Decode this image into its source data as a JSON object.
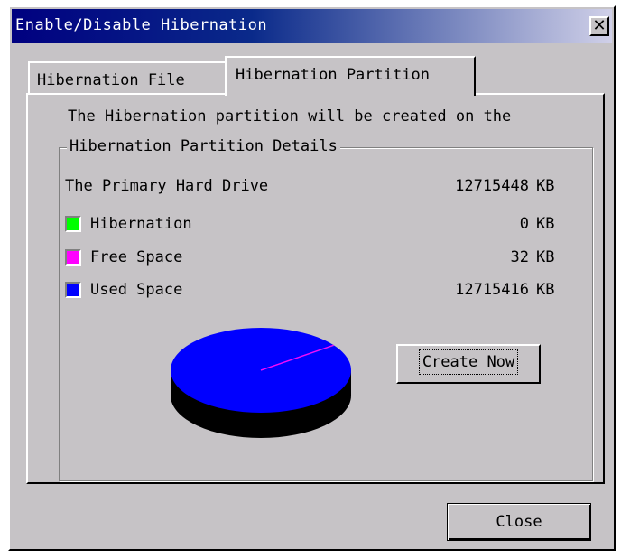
{
  "window": {
    "title": "Enable/Disable Hibernation",
    "close_glyph": "✕"
  },
  "tabs": [
    {
      "label": "Hibernation File",
      "active": false
    },
    {
      "label": "Hibernation Partition",
      "active": true
    }
  ],
  "intro_text": "The Hibernation partition will be created on the",
  "group": {
    "legend": "Hibernation Partition Details",
    "drive": {
      "label": "The Primary Hard Drive",
      "value": "12715448",
      "unit": "KB"
    },
    "items": [
      {
        "label": "Hibernation",
        "value": "0",
        "unit": "KB",
        "color": "#00ff00"
      },
      {
        "label": "Free Space",
        "value": "32",
        "unit": "KB",
        "color": "#ff00ff"
      },
      {
        "label": "Used Space",
        "value": "12715416",
        "unit": "KB",
        "color": "#0000ff"
      }
    ],
    "pie": {
      "slices": [
        {
          "name": "Hibernation",
          "value": 0,
          "color": "#00ff00"
        },
        {
          "name": "Free Space",
          "value": 32,
          "color": "#ff00ff"
        },
        {
          "name": "Used Space",
          "value": 12715416,
          "color": "#0000ff"
        }
      ]
    }
  },
  "buttons": {
    "create_now": "Create Now",
    "close": "Close"
  }
}
